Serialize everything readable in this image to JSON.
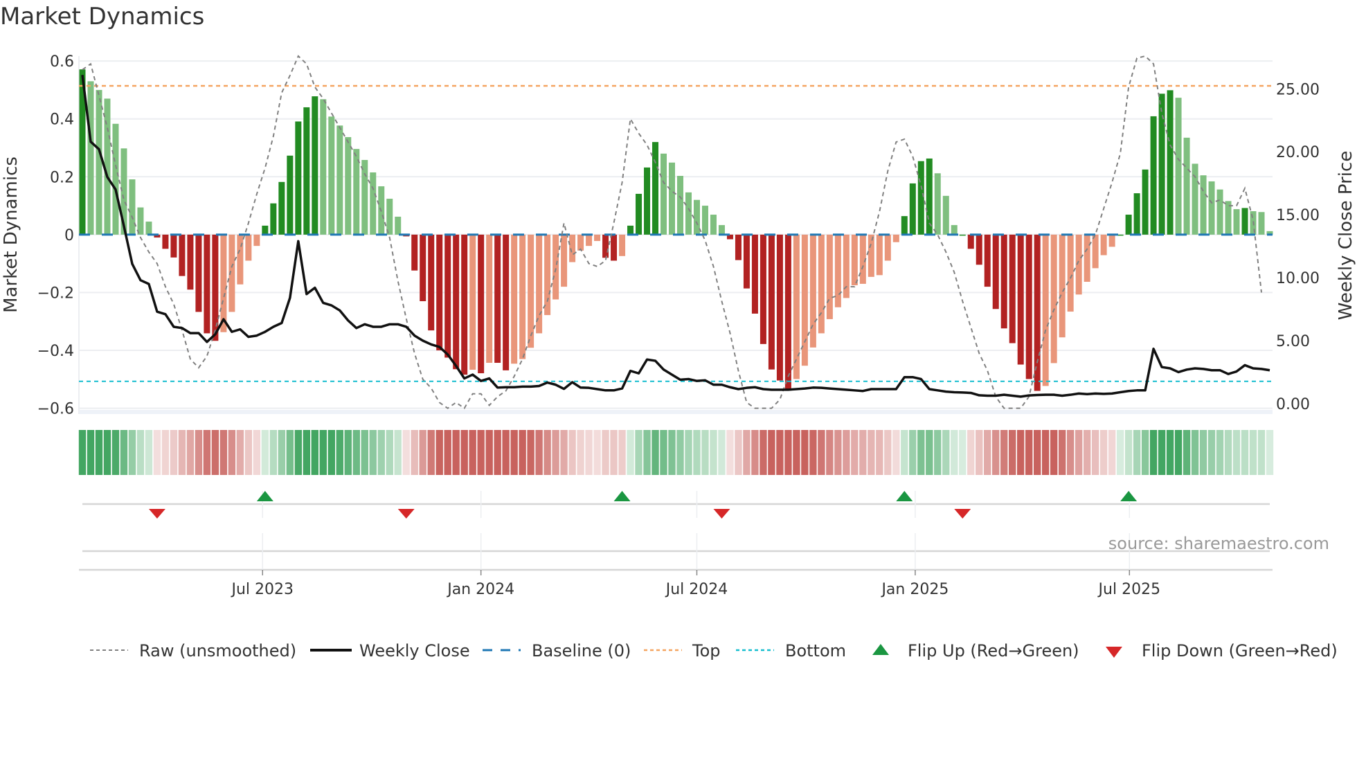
{
  "title": "Market Dynamics",
  "source": "source: sharemaestro.com",
  "legend": {
    "raw": "Raw (unsmoothed)",
    "close": "Weekly Close",
    "baseline": "Baseline (0)",
    "top": "Top",
    "bottom": "Bottom",
    "flip_up": "Flip Up (Red→Green)",
    "flip_down": "Flip Down (Green→Red)"
  },
  "colors": {
    "up_strong": "#228b22",
    "up_weak": "#7fbf7f",
    "down_strong": "#b22222",
    "down_weak": "#e9967a",
    "raw": "#808080",
    "close": "#111111",
    "baseline": "#1f77b4",
    "top": "#f4a460",
    "bottom": "#17becf",
    "flip_up": "#1a9641",
    "flip_down": "#d62728"
  },
  "chart_data": {
    "type": "bar",
    "title": "Market Dynamics",
    "ylabel": "Market Dynamics",
    "y2label": "Weekly Close Price",
    "ylim": [
      -0.62,
      0.617
    ],
    "y2lim": [
      -0.83,
      27.6
    ],
    "yticks": [
      {
        "v": 0.6,
        "label": "0.6"
      },
      {
        "v": 0.4,
        "label": "0.4"
      },
      {
        "v": 0.2,
        "label": "0.2"
      },
      {
        "v": 0,
        "label": "0"
      },
      {
        "v": -0.2,
        "label": "−0.2"
      },
      {
        "v": -0.4,
        "label": "−0.4"
      },
      {
        "v": -0.6,
        "label": "−0.6"
      }
    ],
    "y2ticks": [
      {
        "v": 25,
        "label": "25.00"
      },
      {
        "v": 20,
        "label": "20.00"
      },
      {
        "v": 15,
        "label": "15.00"
      },
      {
        "v": 10,
        "label": "10.00"
      },
      {
        "v": 5,
        "label": "5.00"
      },
      {
        "v": 0,
        "label": "0.00"
      }
    ],
    "xticks": [
      {
        "x": 21.7,
        "label": "Jul 2023"
      },
      {
        "x": 48.0,
        "label": "Jan 2024"
      },
      {
        "x": 74.0,
        "label": "Jul 2024"
      },
      {
        "x": 100.3,
        "label": "Jan 2025"
      },
      {
        "x": 126.1,
        "label": "Jul 2025"
      }
    ],
    "top_level": 0.514,
    "bottom_level": -0.507,
    "baseline": 0,
    "values": [
      0.571,
      0.53,
      0.5,
      0.47,
      0.383,
      0.298,
      0.191,
      0.094,
      0.045,
      -0.01,
      -0.049,
      -0.079,
      -0.143,
      -0.19,
      -0.267,
      -0.341,
      -0.367,
      -0.337,
      -0.267,
      -0.172,
      -0.09,
      -0.039,
      0.031,
      0.108,
      0.182,
      0.273,
      0.391,
      0.44,
      0.478,
      0.468,
      0.408,
      0.377,
      0.337,
      0.296,
      0.258,
      0.215,
      0.167,
      0.124,
      0.062,
      -0.006,
      -0.124,
      -0.23,
      -0.331,
      -0.4,
      -0.425,
      -0.465,
      -0.484,
      -0.467,
      -0.479,
      -0.443,
      -0.443,
      -0.469,
      -0.446,
      -0.43,
      -0.391,
      -0.341,
      -0.278,
      -0.224,
      -0.18,
      -0.095,
      -0.055,
      -0.039,
      -0.022,
      -0.08,
      -0.09,
      -0.074,
      0.031,
      0.141,
      0.232,
      0.32,
      0.28,
      0.249,
      0.203,
      0.146,
      0.12,
      0.1,
      0.069,
      0.033,
      -0.016,
      -0.088,
      -0.186,
      -0.273,
      -0.378,
      -0.466,
      -0.504,
      -0.534,
      -0.499,
      -0.453,
      -0.39,
      -0.341,
      -0.292,
      -0.251,
      -0.219,
      -0.175,
      -0.17,
      -0.146,
      -0.14,
      -0.09,
      -0.026,
      0.064,
      0.177,
      0.254,
      0.263,
      0.212,
      0.134,
      0.033,
      0.0,
      -0.049,
      -0.104,
      -0.18,
      -0.257,
      -0.324,
      -0.375,
      -0.449,
      -0.499,
      -0.54,
      -0.523,
      -0.444,
      -0.355,
      -0.266,
      -0.207,
      -0.163,
      -0.116,
      -0.071,
      -0.042,
      0.0,
      0.069,
      0.143,
      0.225,
      0.409,
      0.487,
      0.499,
      0.473,
      0.335,
      0.245,
      0.205,
      0.184,
      0.156,
      0.116,
      0.088,
      0.092,
      0.081,
      0.078,
      0.012
    ],
    "raw": [
      0.57,
      0.59,
      0.48,
      0.37,
      0.24,
      0.12,
      0.06,
      -0.01,
      -0.06,
      -0.1,
      -0.18,
      -0.24,
      -0.33,
      -0.43,
      -0.46,
      -0.42,
      -0.33,
      -0.22,
      -0.11,
      -0.05,
      0.04,
      0.14,
      0.23,
      0.34,
      0.49,
      0.55,
      0.68,
      0.59,
      0.51,
      0.47,
      0.42,
      0.37,
      0.32,
      0.27,
      0.21,
      0.16,
      0.08,
      -0.01,
      -0.16,
      -0.29,
      -0.41,
      -0.5,
      -0.53,
      -0.58,
      -0.6,
      -0.58,
      -0.6,
      -0.55,
      -0.55,
      -0.59,
      -0.56,
      -0.54,
      -0.49,
      -0.43,
      -0.35,
      -0.28,
      -0.23,
      -0.12,
      0.04,
      -0.07,
      -0.05,
      -0.1,
      -0.11,
      -0.09,
      0.04,
      0.18,
      0.4,
      0.35,
      0.31,
      0.25,
      0.18,
      0.15,
      0.13,
      0.09,
      0.04,
      -0.02,
      -0.11,
      -0.23,
      -0.34,
      -0.47,
      -0.58,
      -0.6,
      -0.6,
      -0.6,
      -0.57,
      -0.49,
      -0.43,
      -0.37,
      -0.31,
      -0.27,
      -0.22,
      -0.21,
      -0.18,
      -0.18,
      -0.11,
      -0.03,
      0.08,
      0.22,
      0.32,
      0.33,
      0.27,
      0.17,
      0.04,
      0.0,
      -0.06,
      -0.13,
      -0.23,
      -0.32,
      -0.41,
      -0.47,
      -0.56,
      -0.6,
      -0.6,
      -0.6,
      -0.56,
      -0.44,
      -0.33,
      -0.26,
      -0.2,
      -0.15,
      -0.09,
      -0.05,
      0.0,
      0.09,
      0.18,
      0.28,
      0.51,
      0.61,
      0.62,
      0.59,
      0.42,
      0.31,
      0.26,
      0.23,
      0.2,
      0.15,
      0.11,
      0.12,
      0.1,
      0.1,
      0.16,
      0.05,
      -0.2
    ],
    "close": [
      26.1,
      20.8,
      20.2,
      18.0,
      17.0,
      14.1,
      11.1,
      9.8,
      9.5,
      7.3,
      7.1,
      6.1,
      6.0,
      5.6,
      5.6,
      4.9,
      5.5,
      6.7,
      5.7,
      5.9,
      5.3,
      5.4,
      5.7,
      6.1,
      6.4,
      8.4,
      12.9,
      8.7,
      9.2,
      8.0,
      7.8,
      7.4,
      6.6,
      6.0,
      6.3,
      6.1,
      6.1,
      6.3,
      6.3,
      6.1,
      5.4,
      5.0,
      4.7,
      4.5,
      3.9,
      3.0,
      2.0,
      2.3,
      1.8,
      2.0,
      1.27,
      1.3,
      1.3,
      1.35,
      1.35,
      1.4,
      1.67,
      1.5,
      1.17,
      1.7,
      1.27,
      1.25,
      1.15,
      1.05,
      1.05,
      1.2,
      2.6,
      2.4,
      3.5,
      3.4,
      2.7,
      2.3,
      1.9,
      1.95,
      1.8,
      1.85,
      1.5,
      1.5,
      1.3,
      1.15,
      1.25,
      1.3,
      1.15,
      1.1,
      1.1,
      1.1,
      1.15,
      1.2,
      1.27,
      1.25,
      1.2,
      1.15,
      1.1,
      1.05,
      1.0,
      1.15,
      1.15,
      1.15,
      1.15,
      2.1,
      2.1,
      1.95,
      1.15,
      1.05,
      0.95,
      0.9,
      0.88,
      0.85,
      0.66,
      0.63,
      0.63,
      0.7,
      0.63,
      0.55,
      0.65,
      0.68,
      0.7,
      0.7,
      0.63,
      0.7,
      0.8,
      0.75,
      0.8,
      0.77,
      0.8,
      0.9,
      1.0,
      1.05,
      1.05,
      4.35,
      2.9,
      2.8,
      2.5,
      2.7,
      2.8,
      2.75,
      2.65,
      2.65,
      2.35,
      2.55,
      3.05,
      2.8,
      2.75,
      2.65
    ],
    "flip_up": [
      22,
      65,
      99,
      126
    ],
    "flip_down": [
      9,
      39,
      77,
      106
    ]
  }
}
